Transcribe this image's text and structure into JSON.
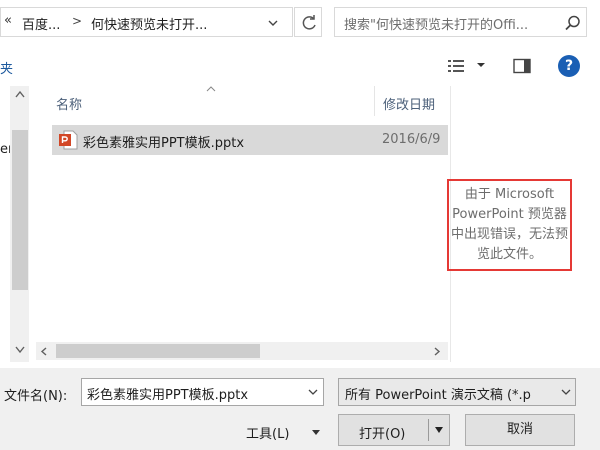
{
  "address_bar": {
    "overflow_chevron": "«",
    "crumbs": [
      "百度...",
      "何快速预览未打开..."
    ],
    "separator": ">"
  },
  "search": {
    "placeholder": "搜索\"何快速预览未打开的Offi..."
  },
  "toolbar": {
    "left_fragment": "夹",
    "help_label": "?"
  },
  "nav": {
    "fragment": "er"
  },
  "file_list": {
    "columns": [
      "名称",
      "修改日期"
    ],
    "rows": [
      {
        "name": "彩色素雅实用PPT模板.pptx",
        "date": "2016/6/9",
        "icon": "powerpoint-file-icon"
      }
    ]
  },
  "preview": {
    "message": "由于 Microsoft PowerPoint 预览器中出现错误，无法预览此文件。"
  },
  "footer": {
    "filename_label": "文件名(N):",
    "filename_value": "彩色素雅实用PPT模板.pptx",
    "filetype_value": "所有 PowerPoint 演示文稿 (*.p",
    "tools_label": "工具(L)",
    "open_label": "打开(O)",
    "cancel_label": "取消"
  },
  "colors": {
    "accent": "#1a5fb4",
    "highlight_border": "#e53935",
    "selected_row": "#d9d9d9",
    "ppt_orange": "#d24726"
  }
}
